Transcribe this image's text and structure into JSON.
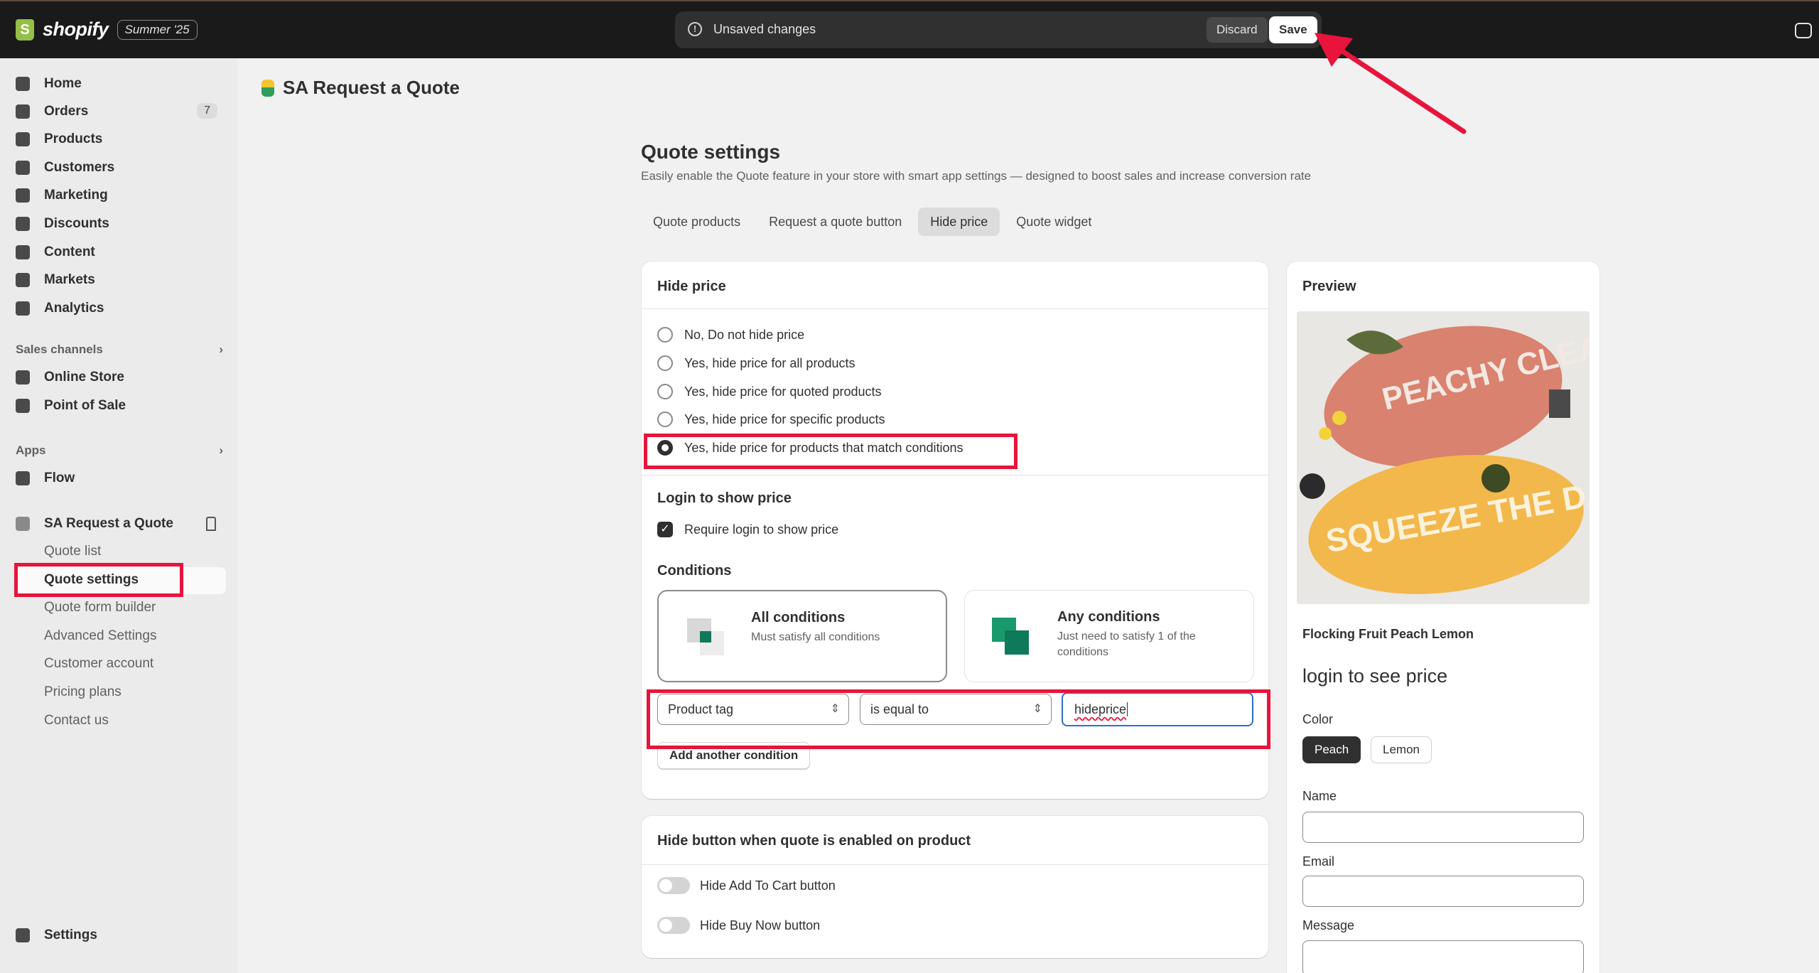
{
  "topbar": {
    "brand": "shopify",
    "edition_badge": "Summer '25",
    "unsaved_message": "Unsaved changes",
    "discard_label": "Discard",
    "save_label": "Save"
  },
  "sidebar": {
    "items": [
      {
        "label": "Home",
        "icon": "home-icon"
      },
      {
        "label": "Orders",
        "icon": "inbox-icon",
        "count": "7"
      },
      {
        "label": "Products",
        "icon": "tag-icon"
      },
      {
        "label": "Customers",
        "icon": "person-icon"
      },
      {
        "label": "Marketing",
        "icon": "target-icon"
      },
      {
        "label": "Discounts",
        "icon": "discount-icon"
      },
      {
        "label": "Content",
        "icon": "content-icon"
      },
      {
        "label": "Markets",
        "icon": "globe-icon"
      },
      {
        "label": "Analytics",
        "icon": "bar-chart-icon"
      }
    ],
    "sales_channels_label": "Sales channels",
    "channels": [
      {
        "label": "Online Store",
        "icon": "store-icon"
      },
      {
        "label": "Point of Sale",
        "icon": "pos-icon"
      }
    ],
    "apps_label": "Apps",
    "apps": [
      {
        "label": "Flow",
        "icon": "flow-icon"
      }
    ],
    "app_section": {
      "label": "SA Request a Quote",
      "subitems": [
        "Quote list",
        "Quote settings",
        "Quote form builder",
        "Advanced Settings",
        "Customer account",
        "Pricing plans",
        "Contact us"
      ]
    },
    "settings_label": "Settings"
  },
  "main": {
    "app_title": "SA Request a Quote",
    "page_title": "Quote settings",
    "page_subtitle": "Easily enable the Quote feature in your store with smart app settings — designed to boost sales and increase conversion rate",
    "tabs": [
      "Quote products",
      "Request a quote button",
      "Hide price",
      "Quote widget"
    ],
    "active_tab": "Hide price",
    "hide_price": {
      "title": "Hide price",
      "options": [
        "No, Do not hide price",
        "Yes, hide price for all products",
        "Yes, hide price for quoted products",
        "Yes, hide price for specific products",
        "Yes, hide price for products that match conditions"
      ],
      "selected_index": 4,
      "login_title": "Login to show price",
      "login_checkbox": "Require login to show price",
      "conditions_title": "Conditions",
      "all_conditions": {
        "title": "All conditions",
        "desc": "Must satisfy all conditions"
      },
      "any_conditions": {
        "title": "Any conditions",
        "desc": "Just need to satisfy 1 of the conditions"
      },
      "condition_field": "Product tag",
      "condition_operator": "is equal to",
      "condition_value": "hideprice",
      "add_condition_label": "Add another condition"
    },
    "hide_button": {
      "title": "Hide button when quote is enabled on product",
      "toggles": [
        "Hide Add To Cart button",
        "Hide Buy Now button"
      ]
    }
  },
  "preview": {
    "title": "Preview",
    "image_text_1": "PEACHY CLEAN",
    "image_text_2": "SQUEEZE THE DAY",
    "product_name": "Flocking Fruit Peach Lemon",
    "price_text": "login to see price",
    "color_label": "Color",
    "colors": [
      "Peach",
      "Lemon"
    ],
    "selected_color": "Peach",
    "fields": [
      "Name",
      "Email",
      "Message"
    ]
  },
  "colors": {
    "topbar_bg": "#1a1a1a",
    "highlight": "#e8143c",
    "focus_blue": "#2c6ecb",
    "primary_dark": "#303030"
  }
}
